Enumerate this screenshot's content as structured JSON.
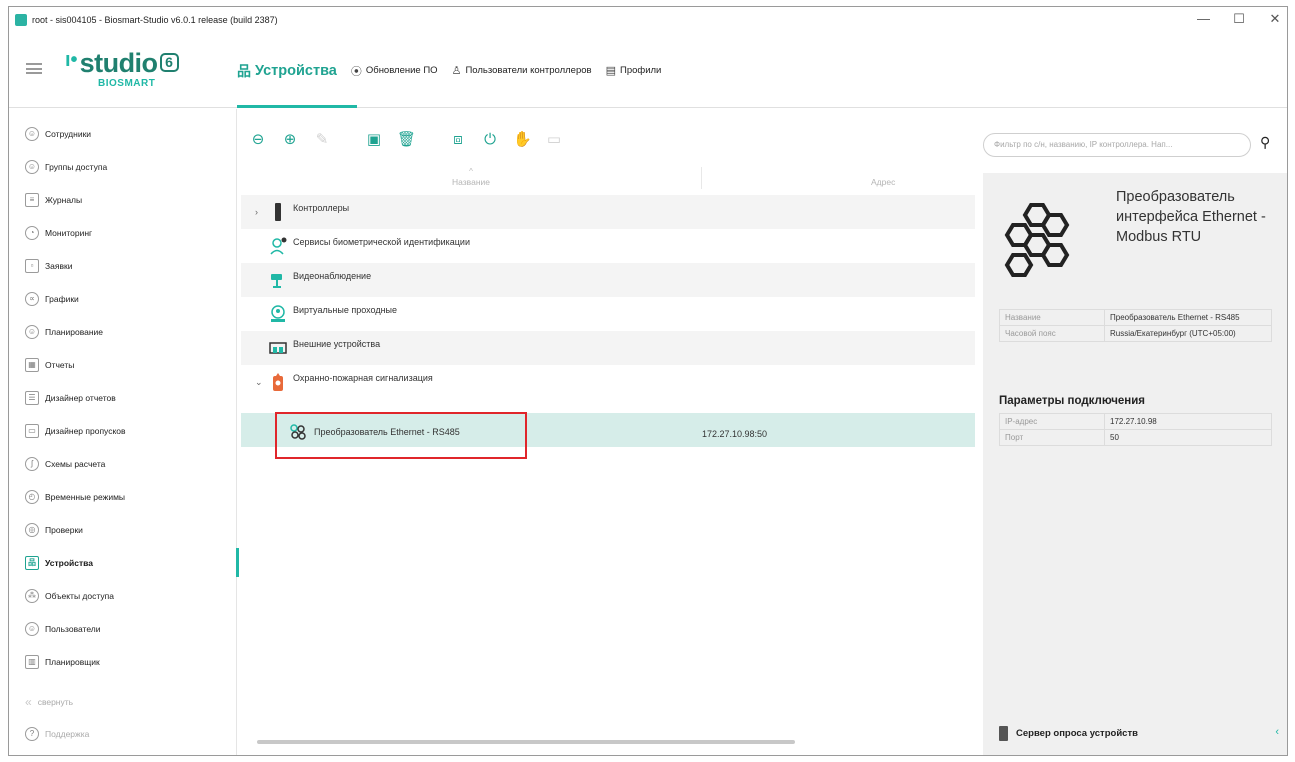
{
  "window": {
    "title": "root - sis004105 - Biosmart-Studio v6.0.1 release (build 2387)",
    "minimize": "—",
    "maximize": "☐",
    "close": "✕"
  },
  "logo": {
    "studio": "studio",
    "version": "6",
    "brand": "BIOSMART"
  },
  "topnav": {
    "tabs": [
      {
        "label": "Устройства",
        "icon": "devices-icon"
      },
      {
        "label": "Обновление ПО",
        "icon": "update-icon"
      },
      {
        "label": "Пользователи контроллеров",
        "icon": "user-icon"
      },
      {
        "label": "Профили",
        "icon": "profile-icon"
      }
    ]
  },
  "sidebar": {
    "items": [
      {
        "label": "Сотрудники",
        "icon": "person-icon"
      },
      {
        "label": "Группы доступа",
        "icon": "group-icon"
      },
      {
        "label": "Журналы",
        "icon": "journal-icon"
      },
      {
        "label": "Мониторинг",
        "icon": "monitoring-icon"
      },
      {
        "label": "Заявки",
        "icon": "request-icon"
      },
      {
        "label": "Графики",
        "icon": "schedule-icon"
      },
      {
        "label": "Планирование",
        "icon": "planning-icon"
      },
      {
        "label": "Отчеты",
        "icon": "report-icon"
      },
      {
        "label": "Дизайнер отчетов",
        "icon": "report-designer-icon"
      },
      {
        "label": "Дизайнер пропусков",
        "icon": "pass-designer-icon"
      },
      {
        "label": "Схемы расчета",
        "icon": "calc-scheme-icon"
      },
      {
        "label": "Временные режимы",
        "icon": "time-mode-icon"
      },
      {
        "label": "Проверки",
        "icon": "check-icon"
      },
      {
        "label": "Устройства",
        "icon": "devices-icon"
      },
      {
        "label": "Объекты доступа",
        "icon": "access-objects-icon"
      },
      {
        "label": "Пользователи",
        "icon": "users-icon"
      },
      {
        "label": "Планировщик",
        "icon": "scheduler-icon"
      }
    ],
    "collapse_label": "свернуть",
    "support_label": "Поддержка"
  },
  "filter": {
    "placeholder": "Фильтр по с/н, названию, IP контроллера. Нап..."
  },
  "table": {
    "col_name": "Название",
    "col_address": "Адрес",
    "rows": [
      {
        "label": "Контроллеры",
        "icon": "controller-icon"
      },
      {
        "label": "Сервисы биометрической идентификации",
        "icon": "biometric-icon"
      },
      {
        "label": "Видеонаблюдение",
        "icon": "camera-icon"
      },
      {
        "label": "Виртуальные проходные",
        "icon": "virtual-checkpoint-icon"
      },
      {
        "label": "Внешние устройства",
        "icon": "external-device-icon"
      },
      {
        "label": "Охранно-пожарная сигнализация",
        "icon": "fire-alarm-icon"
      }
    ],
    "child": {
      "label": "Преобразователь Ethernet - RS485",
      "address": "172.27.10.98:50",
      "icon": "converter-icon"
    }
  },
  "panel": {
    "title": "Преобразователь интерфейса Ethernet - Modbus RTU",
    "props": [
      {
        "key": "Название",
        "value": "Преобразователь Ethernet - RS485"
      },
      {
        "key": "Часовой пояс",
        "value": "Russia/Екатеринбург (UTC+05:00)"
      }
    ],
    "section_title": "Параметры подключения",
    "conn": [
      {
        "key": "IP-адрес",
        "value": "172.27.10.98"
      },
      {
        "key": "Порт",
        "value": "50"
      }
    ],
    "footer": "Сервер опроса устройств"
  },
  "colors": {
    "accent": "#20b8a6",
    "selected_row": "#d6ede9",
    "highlight": "#e0262b"
  }
}
